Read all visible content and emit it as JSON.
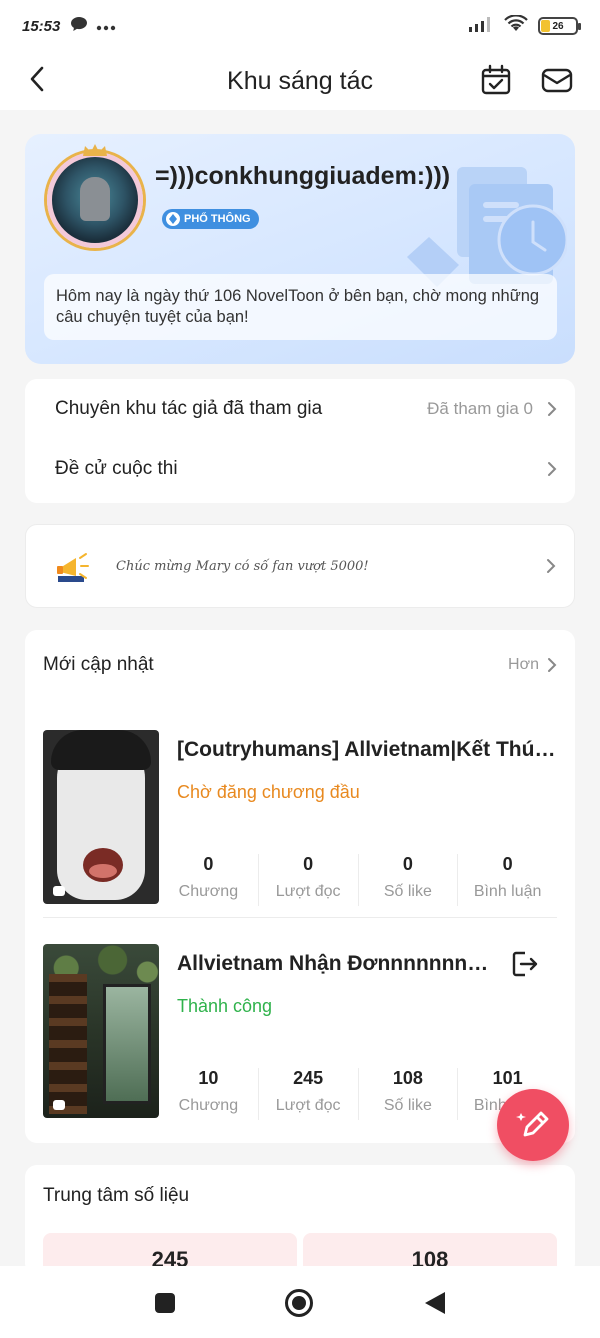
{
  "status_bar": {
    "time": "15:53",
    "battery": "26",
    "battery_level_percent": 26,
    "icons": [
      "chat-bubble-icon",
      "more-dots-icon",
      "signal-icon",
      "wifi-icon",
      "battery-icon"
    ]
  },
  "header": {
    "title": "Khu sáng tác",
    "icons": [
      "back-arrow-icon",
      "calendar-check-icon",
      "mail-icon"
    ]
  },
  "profile": {
    "username": "=)))conkhunggiuadem:)))",
    "badge": "PHỔ THÔNG",
    "greeting": "Hôm nay là ngày thứ 106 NovelToon ở bên bạn, chờ mong những câu chuyện tuyệt của bạn!"
  },
  "menu": {
    "items": [
      {
        "label": "Chuyên khu tác giả đã tham gia",
        "value": "Đã tham gia 0"
      },
      {
        "label": "Đề cử cuộc thi",
        "value": ""
      }
    ]
  },
  "notice": {
    "text": "Chúc mừng Mary có số fan vượt 5000!",
    "icon": "megaphone-icon"
  },
  "updates": {
    "title": "Mới cập nhật",
    "more": "Hơn",
    "stories": [
      {
        "name": "[Coutryhumans] Allvietnam|Kết Thúc ...",
        "status": "Chờ đăng chương đầu",
        "status_color": "#e8891f",
        "stats": [
          {
            "num": "0",
            "label": "Chương"
          },
          {
            "num": "0",
            "label": "Lượt đọc"
          },
          {
            "num": "0",
            "label": "Số like"
          },
          {
            "num": "0",
            "label": "Bình luận"
          }
        ]
      },
      {
        "name": "Allvietnam Nhận Đơnnnnnnnnn...",
        "status": "Thành công",
        "status_color": "#2fb24b",
        "stats": [
          {
            "num": "10",
            "label": "Chương"
          },
          {
            "num": "245",
            "label": "Lượt đọc"
          },
          {
            "num": "108",
            "label": "Số like"
          },
          {
            "num": "101",
            "label": "Bình luận"
          }
        ]
      }
    ]
  },
  "data_center": {
    "title": "Trung tâm số liệu",
    "values": [
      "245",
      "108"
    ]
  },
  "colors": {
    "accent": "#f04e63",
    "badge": "#3f8fe0",
    "pending": "#e8891f",
    "success": "#2fb24b"
  }
}
